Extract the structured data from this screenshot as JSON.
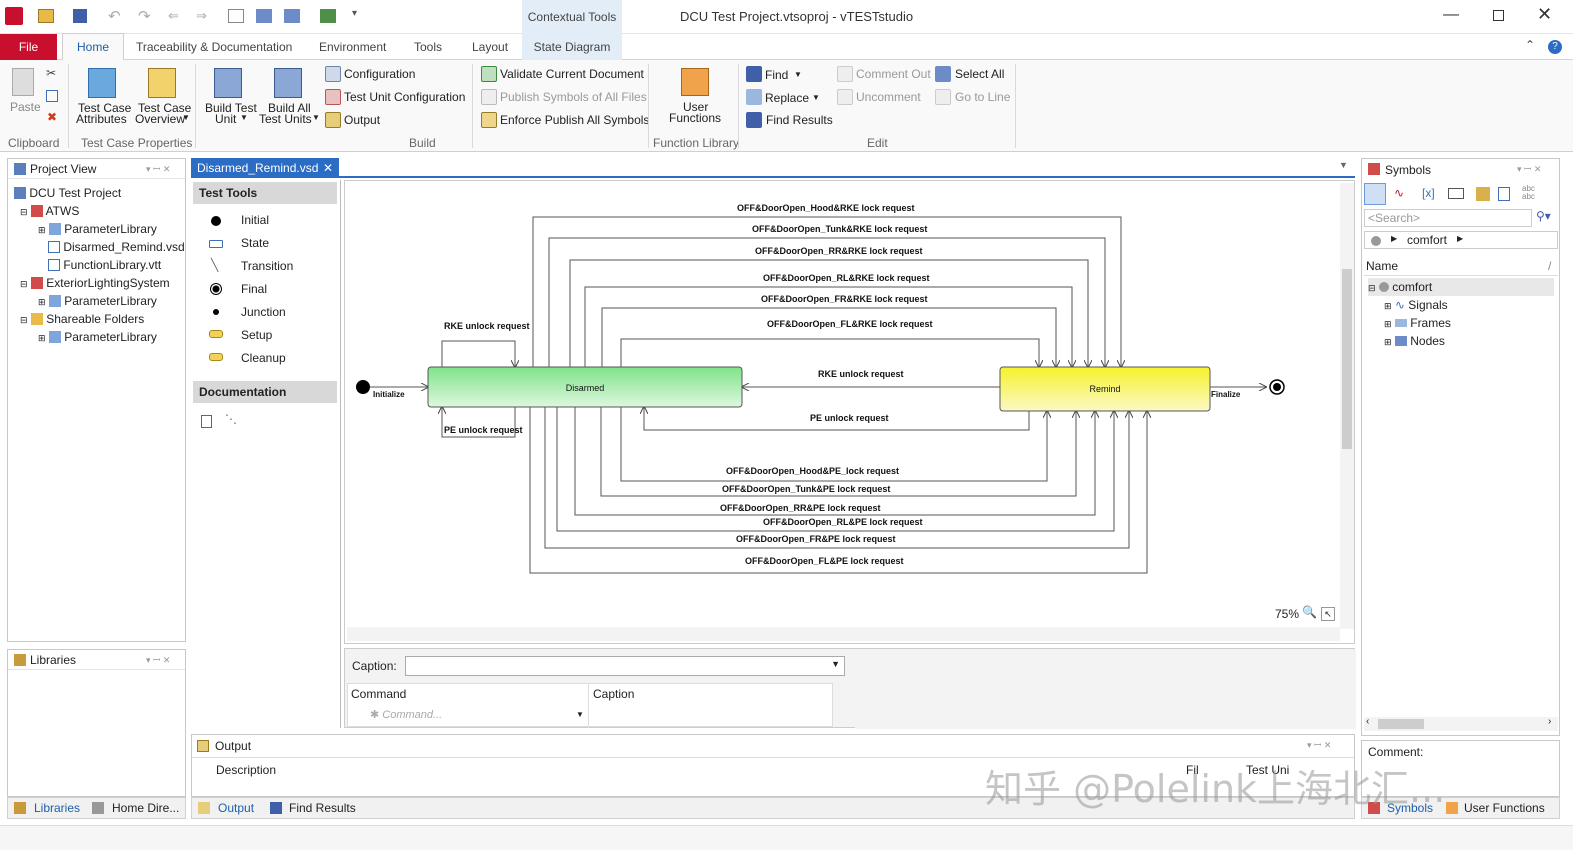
{
  "window": {
    "title": "DCU Test Project.vtsoproj - vTESTstudio",
    "contextual_tools": "Contextual Tools"
  },
  "tabs": {
    "file": "File",
    "home": "Home",
    "traceability": "Traceability & Documentation",
    "environment": "Environment",
    "tools": "Tools",
    "layout": "Layout",
    "state_diagram": "State Diagram"
  },
  "ribbon": {
    "paste": "Paste",
    "clipboard": "Clipboard",
    "tc_attr_1": "Test Case",
    "tc_attr_2": "Attributes",
    "tc_over_1": "Test Case",
    "tc_over_2": "Overview",
    "tc_props": "Test Case Properties",
    "build_unit_1": "Build Test",
    "build_unit_2": "Unit",
    "build_all_1": "Build All",
    "build_all_2": "Test Units",
    "configuration": "Configuration",
    "test_unit_config": "Test Unit Configuration",
    "output": "Output",
    "build": "Build",
    "validate": "Validate Current Document",
    "publish_symbols": "Publish Symbols of All Files",
    "enforce_publish": "Enforce Publish All Symbols",
    "user_fn_1": "User",
    "user_fn_2": "Functions",
    "function_library": "Function Library",
    "find": "Find",
    "replace": "Replace",
    "find_results": "Find Results",
    "comment_out": "Comment Out",
    "uncomment": "Uncomment",
    "select_all": "Select All",
    "go_to_line": "Go to Line",
    "edit": "Edit"
  },
  "project_view": {
    "title": "Project View",
    "items": [
      "DCU Test Project",
      "ATWS",
      "ParameterLibrary",
      "Disarmed_Remind.vsd",
      "FunctionLibrary.vtt",
      "ExteriorLightingSystem",
      "ParameterLibrary",
      "Shareable Folders",
      "ParameterLibrary"
    ]
  },
  "libraries": {
    "title": "Libraries"
  },
  "left_bottom_tabs": {
    "libraries": "Libraries",
    "home_dir": "Home Dire..."
  },
  "doc_tab": {
    "name": "Disarmed_Remind.vsd"
  },
  "test_tools": {
    "header": "Test Tools",
    "items": [
      "Initial",
      "State",
      "Transition",
      "Final",
      "Junction",
      "Setup",
      "Cleanup"
    ],
    "doc_header": "Documentation"
  },
  "diagram": {
    "disarmed": "Disarmed",
    "remind": "Remind",
    "initialize": "Initialize",
    "finalize": "Finalize",
    "rke_unlock_self": "RKE unlock request",
    "pe_unlock_self": "PE unlock request",
    "rke_unlock": "RKE unlock request",
    "pe_unlock": "PE unlock request",
    "top": [
      "OFF&DoorOpen_Hood&RKE lock request",
      "OFF&DoorOpen_Tunk&RKE lock request",
      "OFF&DoorOpen_RR&RKE lock request",
      "OFF&DoorOpen_RL&RKE lock request",
      "OFF&DoorOpen_FR&RKE lock request",
      "OFF&DoorOpen_FL&RKE lock request"
    ],
    "bottom": [
      "OFF&DoorOpen_Hood&PE_lock request",
      "OFF&DoorOpen_Tunk&PE lock request",
      "OFF&DoorOpen_RR&PE lock request",
      "OFF&DoorOpen_RL&PE lock request",
      "OFF&DoorOpen_FR&PE lock request",
      "OFF&DoorOpen_FL&PE lock request"
    ],
    "zoom": "75%"
  },
  "caption_panel": {
    "caption_label": "Caption:",
    "col_command": "Command",
    "col_caption": "Caption",
    "command_placeholder": "Command..."
  },
  "output_panel": {
    "title": "Output",
    "col_description": "Description",
    "col_file": "Fil",
    "col_test_unit": "Test Uni"
  },
  "bottom_tabs": {
    "output": "Output",
    "find_results": "Find Results"
  },
  "symbols": {
    "title": "Symbols",
    "search_placeholder": "<Search>",
    "breadcrumb": "comfort",
    "col_name": "Name",
    "tree": [
      "comfort",
      "Signals",
      "Frames",
      "Nodes"
    ],
    "comment_label": "Comment:",
    "tab_symbols": "Symbols",
    "tab_user_functions": "User Functions"
  },
  "watermark": "知乎 @Polelink上海北汇..."
}
